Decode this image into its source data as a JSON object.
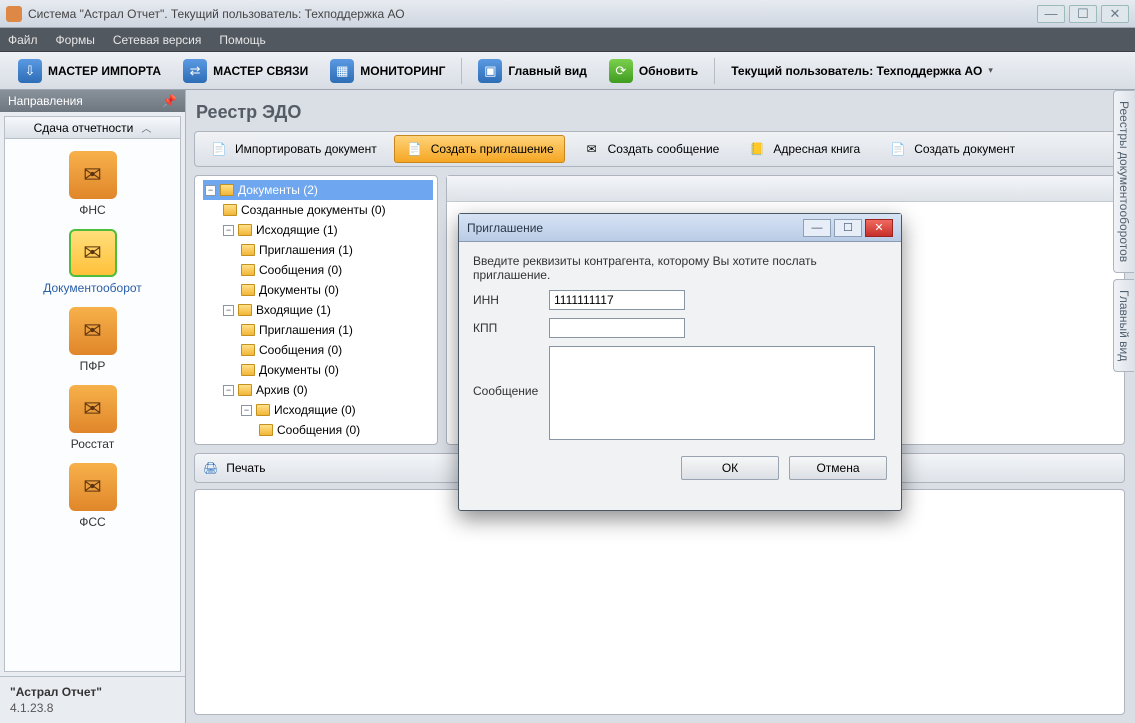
{
  "window": {
    "title": "Система \"Астрал Отчет\". Текущий пользователь: Техподдержка АО"
  },
  "menu": {
    "items": [
      "Файл",
      "Формы",
      "Сетевая версия",
      "Помощь"
    ]
  },
  "toolbarMain": {
    "importMaster": "МАСТЕР ИМПОРТА",
    "commMaster": "МАСТЕР СВЯЗИ",
    "monitoring": "МОНИТОРИНГ",
    "mainView": "Главный вид",
    "refresh": "Обновить",
    "currentUser": "Текущий пользователь: Техподдержка АО"
  },
  "sidePanel": {
    "title": "Направления",
    "section": "Сдача отчетности",
    "items": [
      {
        "label": "ФНС"
      },
      {
        "label": "Документооборот"
      },
      {
        "label": "ПФР"
      },
      {
        "label": "Росстат"
      },
      {
        "label": "ФСС"
      }
    ],
    "productName": "\"Астрал Отчет\"",
    "productVersion": "4.1.23.8"
  },
  "page": {
    "title": "Реестр ЭДО",
    "toolbar": {
      "importDoc": "Импортировать документ",
      "createInvite": "Создать приглашение",
      "createMessage": "Создать сообщение",
      "addressBook": "Адресная книга",
      "createDocument": "Создать документ"
    },
    "tree": {
      "root": "Документы (2)",
      "created": "Созданные документы (0)",
      "outgoing": "Исходящие (1)",
      "outgoingInvites": "Приглашения (1)",
      "outgoingMessages": "Сообщения (0)",
      "outgoingDocs": "Документы (0)",
      "incoming": "Входящие (1)",
      "incomingInvites": "Приглашения (1)",
      "incomingMessages": "Сообщения (0)",
      "incomingDocs": "Документы (0)",
      "archive": "Архив (0)",
      "archiveOut": "Исходящие (0)",
      "archiveOutMsg": "Сообщения (0)"
    },
    "printBar": {
      "label": "Печать"
    }
  },
  "sideTabs": {
    "registry": "Реестры документооборотов",
    "mainView": "Главный вид"
  },
  "modal": {
    "title": "Приглашение",
    "prompt": "Введите реквизиты контрагента, которому Вы хотите послать приглашение.",
    "innLabel": "ИНН",
    "innValue": "1111111117",
    "kppLabel": "КПП",
    "kppValue": "",
    "msgLabel": "Сообщение",
    "msgValue": "",
    "okBtn": "ОК",
    "cancelBtn": "Отмена"
  }
}
